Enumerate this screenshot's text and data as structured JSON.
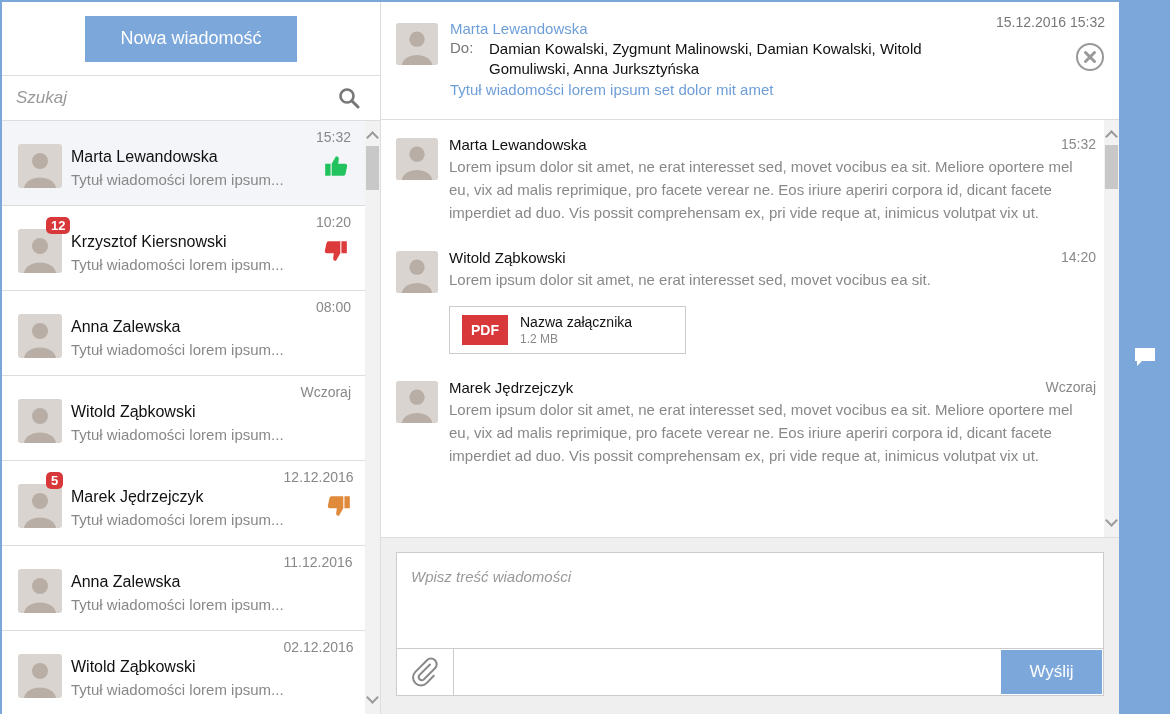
{
  "new_message_button": "Nowa wiadomość",
  "search": {
    "placeholder": "Szukaj"
  },
  "conversations": [
    {
      "name": "Marta Lewandowska",
      "preview": "Tytuł wiadomości lorem ipsum...",
      "time": "15:32",
      "selected": true,
      "kind": "thumbs_up",
      "color": "#22c35e"
    },
    {
      "name": "Krzysztof Kiersnowski",
      "preview": "Tytuł wiadomości lorem ipsum...",
      "time": "10:20",
      "selected": false,
      "badge": "12",
      "kind": "thumbs_down",
      "color": "#dd3b3b"
    },
    {
      "name": "Anna Zalewska",
      "preview": "Tytuł wiadomości lorem ipsum...",
      "time": "08:00",
      "selected": false,
      "kind": "plain"
    },
    {
      "name": "Witold Ząbkowski",
      "preview": "Tytuł wiadomości lorem ipsum...",
      "time": "Wczoraj",
      "selected": false,
      "kind": "plain"
    },
    {
      "name": "Marek Jędrzejczyk",
      "preview": "Tytuł wiadomości lorem ipsum...",
      "time": "12.12.2016",
      "selected": false,
      "badge": "5",
      "kind": "thumbs_down",
      "color": "#e08a3c"
    },
    {
      "name": "Anna Zalewska",
      "preview": "Tytuł wiadomości lorem ipsum...",
      "time": "11.12.2016",
      "selected": false,
      "kind": "plain"
    },
    {
      "name": "Witold Ząbkowski",
      "preview": "Tytuł wiadomości lorem ipsum...",
      "time": "02.12.2016",
      "selected": false,
      "kind": "plain"
    }
  ],
  "header": {
    "sender": "Marta Lewandowska",
    "to_label": "Do:",
    "recipients": "Damian Kowalski, Zygmunt Malinowski, Damian Kowalski, Witold Gomuliwski, Anna Jurksztyńska",
    "subject": "Tytuł wiadomości lorem ipsum set dolor mit amet",
    "date": "15.12.2016 15:32"
  },
  "messages": [
    {
      "author": "Marta Lewandowska",
      "time": "15:32",
      "body": "Lorem ipsum dolor sit amet, ne erat interesset sed, movet vocibus ea sit. Meliore oportere mel eu, vix ad malis reprimique, pro facete verear ne. Eos iriure aperiri corpora id, dicant facete imperdiet ad duo. Vis possit comprehensam ex, pri vide reque at, inimicus volutpat vix ut."
    },
    {
      "author": "Witold Ząbkowski",
      "time": "14:20",
      "body": "Lorem ipsum dolor sit amet, ne erat interesset sed, movet vocibus ea sit.",
      "attachment": {
        "type": "PDF",
        "name": "Nazwa załącznika",
        "size": "1.2 MB"
      }
    },
    {
      "author": "Marek Jędrzejczyk",
      "time": "Wczoraj",
      "body": "Lorem ipsum dolor sit amet, ne erat interesset sed, movet vocibus ea sit. Meliore oportere mel eu, vix ad malis reprimique, pro facete verear ne. Eos iriure aperiri corpora id, dicant facete imperdiet ad duo. Vis possit comprehensam ex, pri vide reque at, inimicus volutpat vix ut."
    }
  ],
  "compose": {
    "placeholder": "Wpisz treść wiadomości",
    "send_button": "Wyślij"
  }
}
